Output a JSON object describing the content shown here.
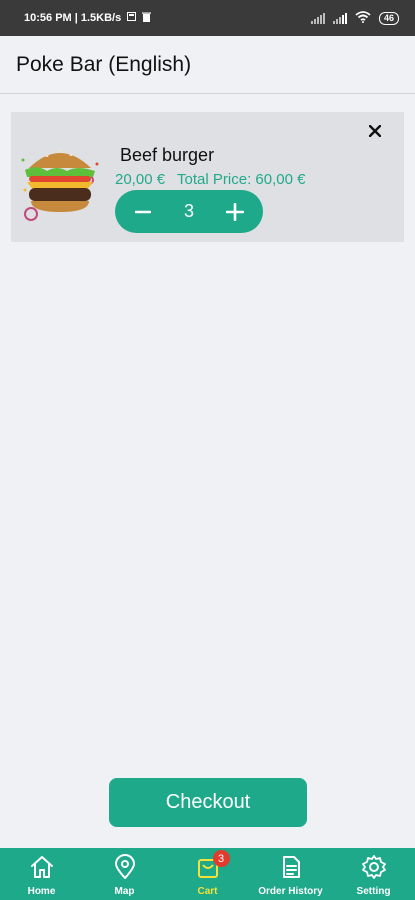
{
  "status_bar": {
    "time_info": "10:56 PM | 1.5KB/s",
    "battery": "46"
  },
  "header": {
    "title": "Poke Bar (English)"
  },
  "cart": {
    "items": [
      {
        "name": "Beef burger",
        "unit_price": "20,00 €",
        "total_price": "Total Price: 60,00 €",
        "quantity": "3",
        "image_icon": "burger-image"
      }
    ]
  },
  "checkout": {
    "label": "Checkout"
  },
  "bottom_nav": {
    "items": [
      {
        "label": "Home",
        "icon": "home-icon"
      },
      {
        "label": "Map",
        "icon": "map-pin-icon"
      },
      {
        "label": "Cart",
        "icon": "cart-icon",
        "badge": "3",
        "active": true
      },
      {
        "label": "Order History",
        "icon": "document-icon"
      },
      {
        "label": "Setting",
        "icon": "gear-icon"
      }
    ]
  },
  "colors": {
    "accent": "#1da98a",
    "price_text": "#21a98a",
    "active_nav": "#f2e23a",
    "badge": "#e23b2e"
  }
}
